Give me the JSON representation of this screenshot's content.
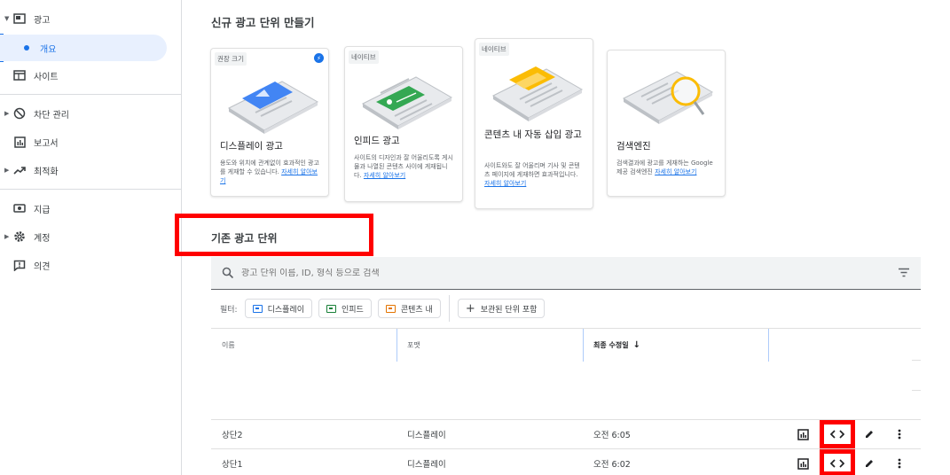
{
  "sidebar": {
    "items": [
      {
        "label": "광고",
        "icon": "ad-unit-icon"
      },
      {
        "label": "개요"
      },
      {
        "label": "사이트",
        "icon": "sites-icon"
      },
      {
        "label": "차단 관리",
        "icon": "block-icon"
      },
      {
        "label": "보고서",
        "icon": "report-icon"
      },
      {
        "label": "최적화",
        "icon": "trending-icon"
      },
      {
        "label": "지급",
        "icon": "payments-icon"
      },
      {
        "label": "계정",
        "icon": "gear-icon"
      },
      {
        "label": "의견",
        "icon": "feedback-icon"
      }
    ]
  },
  "new_section": {
    "title": "신규 광고 단위 만들기",
    "cards": [
      {
        "tag": "권장 크기",
        "title": "디스플레이 광고",
        "desc": "용도와 위치에 관계없이 효과적인 광고를 게재할 수 있습니다.",
        "link": "자세히 알아보기",
        "accent": "#4285f4"
      },
      {
        "tag": "네이티브",
        "title": "인피드 광고",
        "desc": "사이트의 디자인과 잘 어울리도록 게시물과 나열된 콘텐츠 사이에 게재됩니다.",
        "link": "자세히 알아보기",
        "accent": "#34a853"
      },
      {
        "tag": "네이티브",
        "title": "콘텐츠 내 자동 삽입 광고",
        "desc": "사이트와도 잘 어울리며 기사 및 콘텐츠 페이지에 게재하면 효과적입니다.",
        "link": "자세히 알아보기",
        "accent": "#fbbc04"
      },
      {
        "tag": "",
        "title": "검색엔진",
        "desc": "검색결과에 광고를 게재하는 Google 제공 검색엔진",
        "link": "자세히 알아보기",
        "accent": "#fbbc04"
      }
    ]
  },
  "existing": {
    "title": "기존 광고 단위",
    "search_placeholder": "광고 단위 이름, ID, 형식 등으로 검색",
    "filter_label": "필터:",
    "chips": [
      {
        "label": "디스플레이",
        "color": "#1a73e8"
      },
      {
        "label": "인피드",
        "color": "#188038"
      },
      {
        "label": "콘텐츠 내",
        "color": "#e37400"
      }
    ],
    "archived_chip": "보관된 단위 포함",
    "columns": [
      "이름",
      "포맷",
      "최종 수정일"
    ],
    "rows": [
      {
        "name": "상단2",
        "format": "디스플레이",
        "modified": "오전 6:05"
      },
      {
        "name": "상단1",
        "format": "디스플레이",
        "modified": "오전 6:02"
      }
    ]
  }
}
